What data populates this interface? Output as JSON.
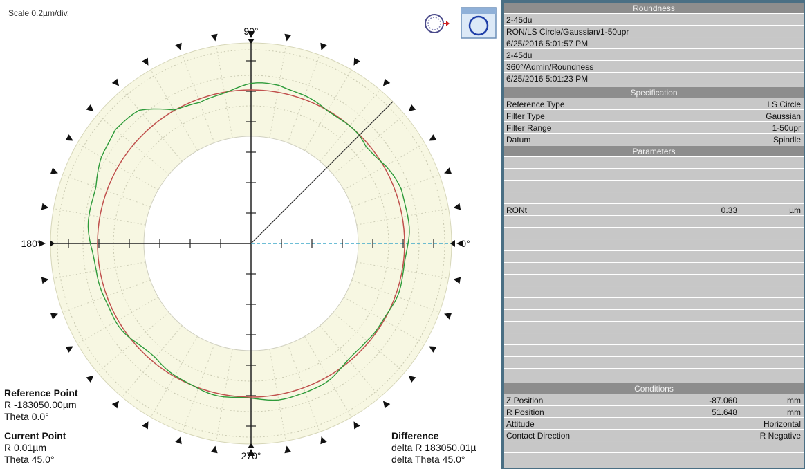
{
  "plot": {
    "scale_text": "Scale 0.2µm/div.",
    "angle_labels": {
      "top": "90°",
      "left": "180°",
      "right": "0°",
      "bottom": "270°"
    },
    "reference_point": {
      "title": "Reference Point",
      "r": "R -183050.00µm",
      "theta": "Theta 0.0°"
    },
    "current_point": {
      "title": "Current Point",
      "r": "R 0.01µm",
      "theta": "Theta 45.0°"
    },
    "difference": {
      "title": "Difference",
      "delta_r": "delta R 183050.01µ",
      "delta_theta": "delta Theta 45.0°"
    },
    "colors": {
      "band": "#f7f7e2",
      "reference_circle": "#c0504d",
      "profile": "#2e9b3a",
      "axis": "#222222",
      "zero_line": "#3fa9c9"
    }
  },
  "chart_data": {
    "type": "polar",
    "title": "Roundness",
    "scale_um_per_div": 0.2,
    "cursor_angle_deg": 45,
    "reference_type": "LS Circle",
    "profile_deviation_um": [
      {
        "theta": 0,
        "r": 0.02
      },
      {
        "theta": 10,
        "r": 0.03
      },
      {
        "theta": 20,
        "r": 0.04
      },
      {
        "theta": 30,
        "r": 0.02
      },
      {
        "theta": 40,
        "r": -0.02
      },
      {
        "theta": 50,
        "r": -0.01
      },
      {
        "theta": 60,
        "r": 0.0
      },
      {
        "theta": 70,
        "r": 0.03
      },
      {
        "theta": 80,
        "r": 0.05
      },
      {
        "theta": 90,
        "r": 0.03
      },
      {
        "theta": 100,
        "r": 0.0
      },
      {
        "theta": 110,
        "r": -0.02
      },
      {
        "theta": 120,
        "r": 0.01
      },
      {
        "theta": 130,
        "r": 0.12
      },
      {
        "theta": 140,
        "r": 0.16
      },
      {
        "theta": 150,
        "r": 0.13
      },
      {
        "theta": 160,
        "r": 0.08
      },
      {
        "theta": 170,
        "r": 0.06
      },
      {
        "theta": 180,
        "r": 0.05
      },
      {
        "theta": 190,
        "r": 0.03
      },
      {
        "theta": 200,
        "r": 0.02
      },
      {
        "theta": 210,
        "r": 0.01
      },
      {
        "theta": 220,
        "r": -0.01
      },
      {
        "theta": 230,
        "r": -0.02
      },
      {
        "theta": 240,
        "r": -0.01
      },
      {
        "theta": 250,
        "r": 0.0
      },
      {
        "theta": 260,
        "r": 0.01
      },
      {
        "theta": 270,
        "r": 0.02
      },
      {
        "theta": 280,
        "r": 0.03
      },
      {
        "theta": 290,
        "r": 0.03
      },
      {
        "theta": 300,
        "r": 0.02
      },
      {
        "theta": 310,
        "r": 0.0
      },
      {
        "theta": 320,
        "r": -0.02
      },
      {
        "theta": 330,
        "r": -0.01
      },
      {
        "theta": 340,
        "r": 0.01
      },
      {
        "theta": 350,
        "r": 0.02
      }
    ]
  },
  "panel": {
    "roundness": {
      "header": "Roundness",
      "lines": [
        "2-45du",
        "RON/LS Circle/Gaussian/1-50upr",
        "6/25/2016 5:01:57 PM",
        "2-45du",
        "360°/Admin/Roundness",
        "6/25/2016 5:01:23 PM"
      ]
    },
    "specification": {
      "header": "Specification",
      "rows": [
        {
          "label": "Reference Type",
          "value": "LS Circle"
        },
        {
          "label": "Filter Type",
          "value": "Gaussian"
        },
        {
          "label": "Filter Range",
          "value": "1-50upr"
        },
        {
          "label": "Datum",
          "value": "Spindle"
        }
      ]
    },
    "parameters": {
      "header": "Parameters",
      "ront": {
        "label": "RONt",
        "value": "0.33",
        "unit": "µm"
      }
    },
    "conditions": {
      "header": "Conditions",
      "rows": [
        {
          "label": "Z Position",
          "value": "-87.060",
          "unit": "mm"
        },
        {
          "label": "R Position",
          "value": "51.648",
          "unit": "mm"
        },
        {
          "label": "Attitude",
          "value": "Horizontal",
          "unit": ""
        },
        {
          "label": "Contact Direction",
          "value": "R Negative",
          "unit": ""
        }
      ]
    }
  }
}
